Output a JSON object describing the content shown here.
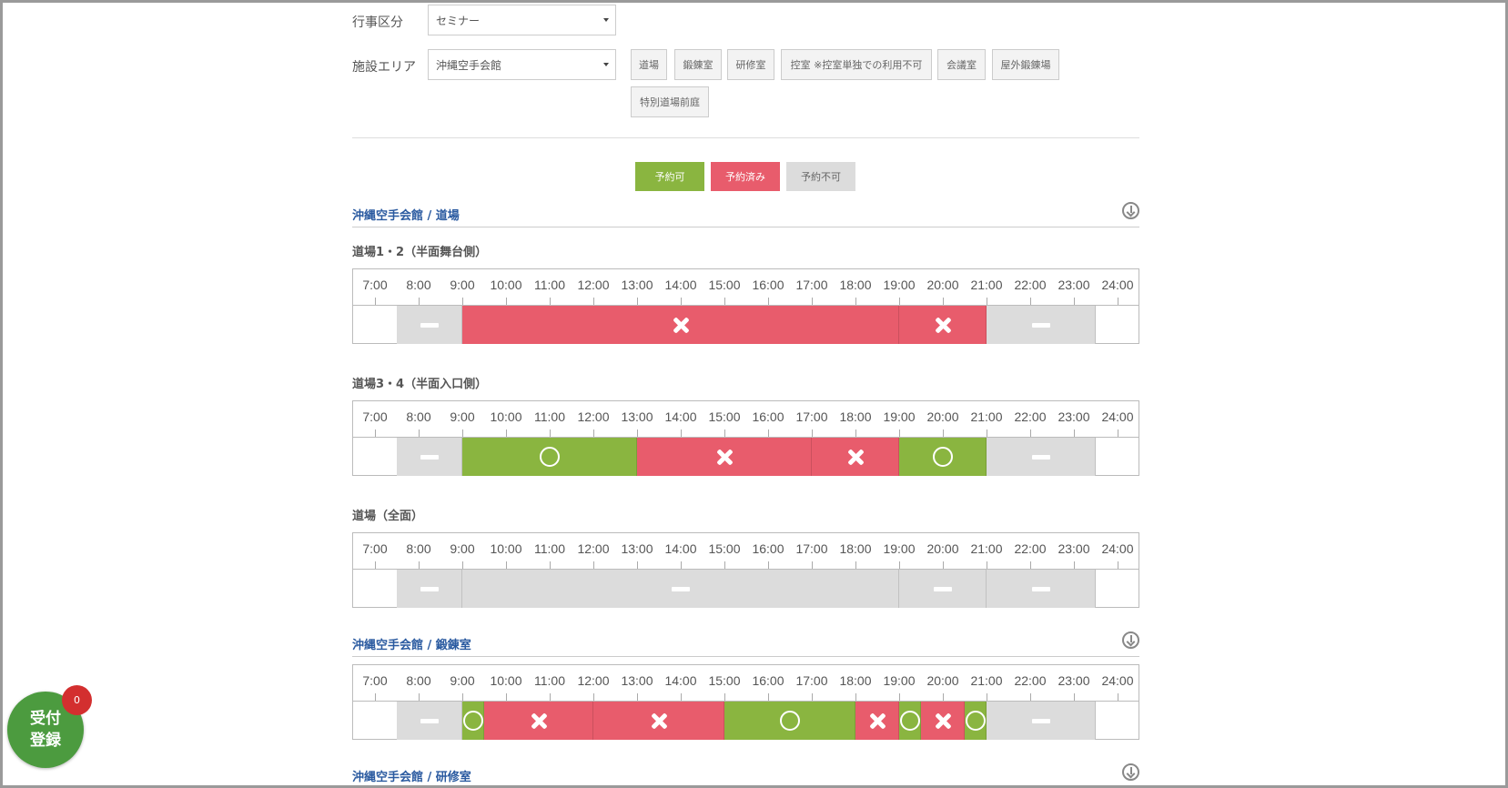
{
  "form": {
    "event_type_label": "行事区分",
    "event_type_value": "セミナー",
    "area_label": "施設エリア",
    "area_value": "沖縄空手会館"
  },
  "facilities": [
    "道場",
    "鍛錬室",
    "研修室",
    "控室 ※控室単独での利用不可",
    "会議室",
    "屋外鍛錬場",
    "特別道場前庭"
  ],
  "legend": {
    "available": "予約可",
    "booked": "予約済み",
    "unavailable": "予約不可",
    "colors": {
      "available": "#8ab540",
      "booked": "#e85c6c",
      "unavailable": "#dcdcdc"
    }
  },
  "time_labels": [
    "7:00",
    "8:00",
    "9:00",
    "10:00",
    "11:00",
    "12:00",
    "13:00",
    "14:00",
    "15:00",
    "16:00",
    "17:00",
    "18:00",
    "19:00",
    "20:00",
    "21:00",
    "22:00",
    "23:00",
    "24:00"
  ],
  "sections": [
    {
      "title": "沖縄空手会館 / 道場",
      "rooms": [
        {
          "name": "道場1・2（半面舞台側）",
          "slots": [
            {
              "start": "7:30",
              "end": "9:00",
              "status": "unavailable"
            },
            {
              "start": "9:00",
              "end": "19:00",
              "status": "booked"
            },
            {
              "start": "19:00",
              "end": "21:00",
              "status": "booked"
            },
            {
              "start": "21:00",
              "end": "23:30",
              "status": "unavailable"
            }
          ]
        },
        {
          "name": "道場3・4（半面入口側）",
          "slots": [
            {
              "start": "7:30",
              "end": "9:00",
              "status": "unavailable"
            },
            {
              "start": "9:00",
              "end": "13:00",
              "status": "available"
            },
            {
              "start": "13:00",
              "end": "17:00",
              "status": "booked"
            },
            {
              "start": "17:00",
              "end": "19:00",
              "status": "booked"
            },
            {
              "start": "19:00",
              "end": "21:00",
              "status": "available"
            },
            {
              "start": "21:00",
              "end": "23:30",
              "status": "unavailable"
            }
          ]
        },
        {
          "name": "道場（全面）",
          "slots": [
            {
              "start": "7:30",
              "end": "9:00",
              "status": "unavailable"
            },
            {
              "start": "9:00",
              "end": "19:00",
              "status": "unavailable"
            },
            {
              "start": "19:00",
              "end": "21:00",
              "status": "unavailable"
            },
            {
              "start": "21:00",
              "end": "23:30",
              "status": "unavailable"
            }
          ]
        }
      ]
    },
    {
      "title": "沖縄空手会館 / 鍛錬室",
      "rooms": [
        {
          "name": "",
          "slots": [
            {
              "start": "7:30",
              "end": "9:00",
              "status": "unavailable"
            },
            {
              "start": "9:00",
              "end": "9:30",
              "status": "available"
            },
            {
              "start": "9:30",
              "end": "12:00",
              "status": "booked"
            },
            {
              "start": "12:00",
              "end": "15:00",
              "status": "booked"
            },
            {
              "start": "15:00",
              "end": "18:00",
              "status": "available"
            },
            {
              "start": "18:00",
              "end": "19:00",
              "status": "booked"
            },
            {
              "start": "19:00",
              "end": "19:30",
              "status": "available"
            },
            {
              "start": "19:30",
              "end": "20:30",
              "status": "booked"
            },
            {
              "start": "20:30",
              "end": "21:00",
              "status": "available"
            },
            {
              "start": "21:00",
              "end": "23:30",
              "status": "unavailable"
            }
          ]
        }
      ]
    },
    {
      "title": "沖縄空手会館 / 研修室",
      "rooms": []
    }
  ],
  "fab": {
    "line1": "受付",
    "line2": "登録",
    "badge": "0"
  }
}
